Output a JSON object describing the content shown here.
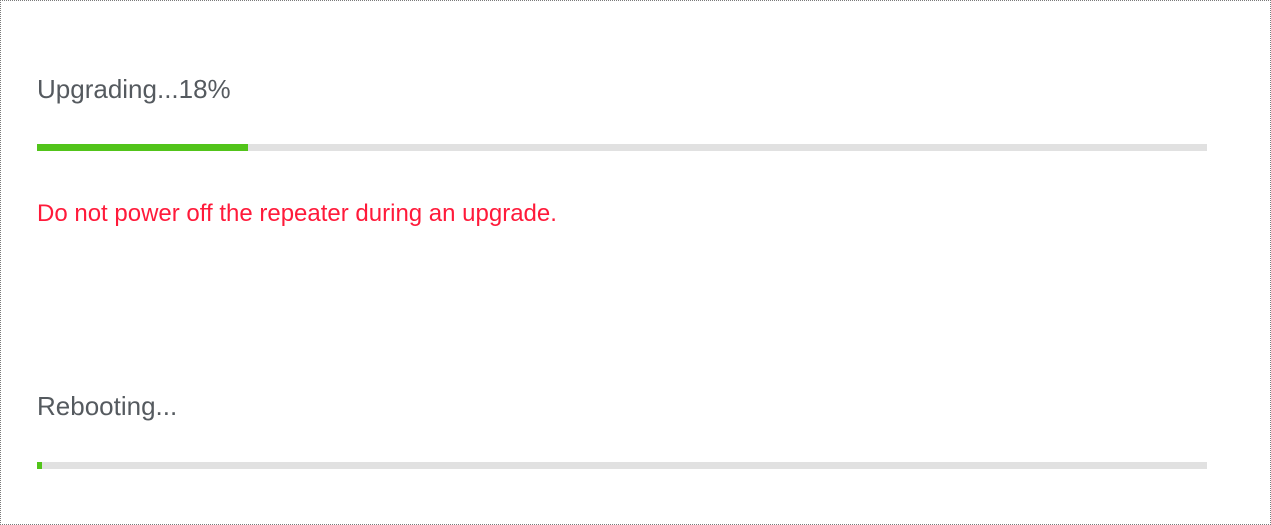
{
  "colors": {
    "progress_fill": "#52c41a",
    "progress_track": "#e1e1e1",
    "warning_text": "#ff1a3a",
    "label_text": "#555a5f"
  },
  "upgrade": {
    "label": "Upgrading...18%",
    "progress": 0.18
  },
  "warning": {
    "text": "Do not power off the repeater during an upgrade."
  },
  "reboot": {
    "label": "Rebooting...",
    "progress": 0.004
  }
}
